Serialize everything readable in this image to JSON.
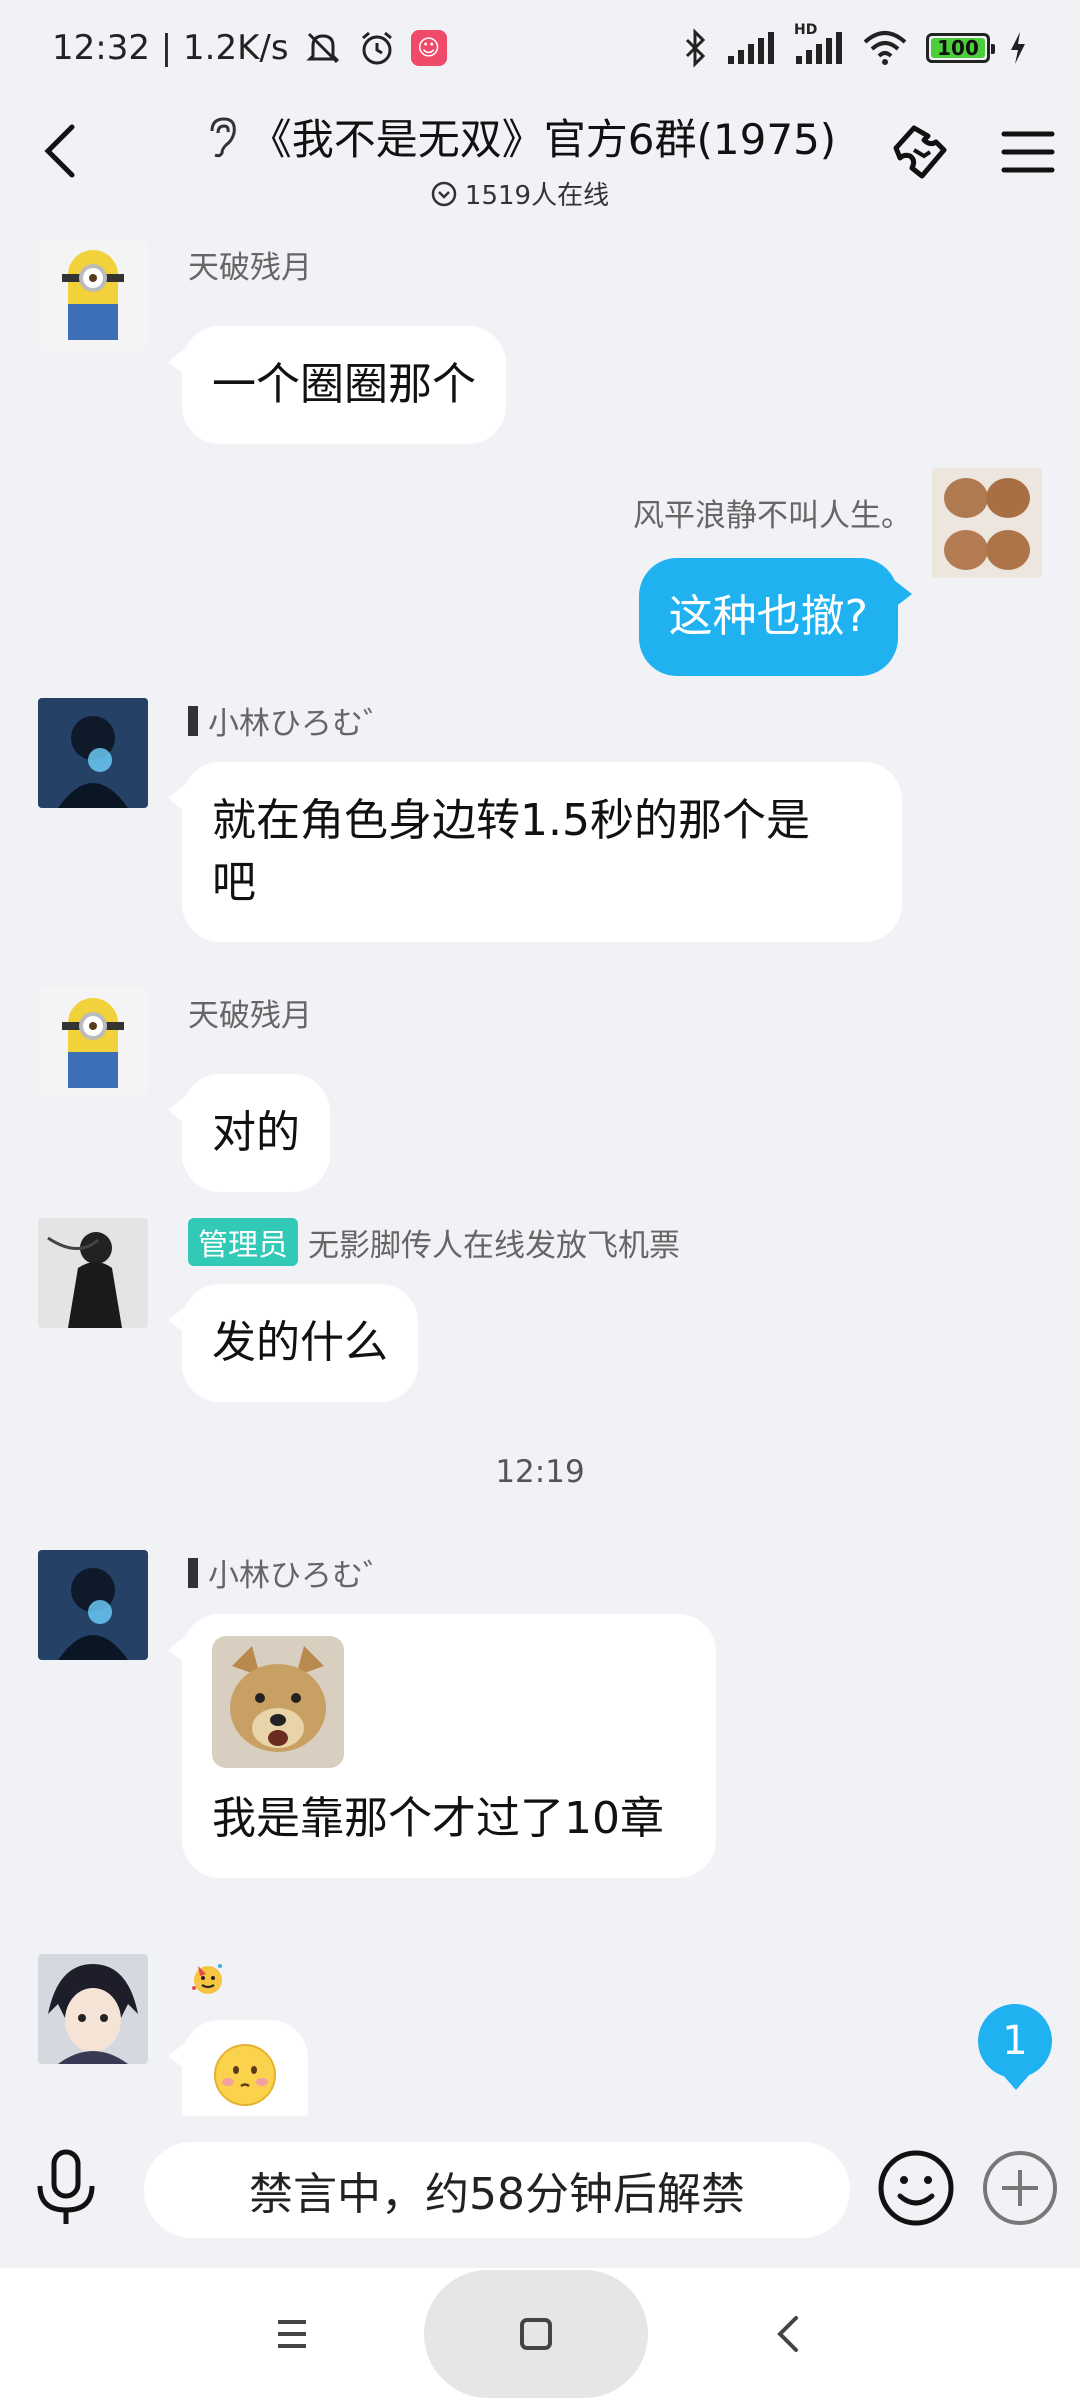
{
  "status_bar": {
    "time_speed": "12:32 | 1.2K/s",
    "battery": "100",
    "signal_hd": "HD"
  },
  "header": {
    "title": "《我不是无双》官方6群(1975)",
    "online": "1519人在线"
  },
  "messages": [
    {
      "sender": "天破残月",
      "text": "一个圈圈那个",
      "avatar": "minion-avatar"
    },
    {
      "sender": "风平浪静不叫人生。",
      "text": "这种也撤?",
      "avatar": "shoes-avatar",
      "mine": true
    },
    {
      "sender": "小林ひろむ゛",
      "text_line1": "就在角色身边转1.5秒的那个是",
      "text_line2": "吧",
      "avatar": "dark-avatar"
    },
    {
      "sender": "天破残月",
      "text": "对的",
      "avatar": "minion-avatar"
    },
    {
      "role": "管理员",
      "sender": "无影脚传人在线发放飞机票",
      "text": "发的什么",
      "avatar": "bw-avatar"
    },
    {
      "time": "12:19"
    },
    {
      "sender": "小林ひろむ゛",
      "text": "我是靠那个才过了10章",
      "avatar": "dark-avatar",
      "sticker": "dog-sticker"
    },
    {
      "sender_icon": "party-emoji",
      "avatar": "anime-avatar",
      "emoji": "blush-emoji"
    }
  ],
  "unread_count": "1",
  "input": {
    "muted_text": "禁言中，约58分钟后解禁"
  },
  "colors": {
    "accent": "#1fb1f0",
    "admin_tag": "#32c9b7",
    "background": "#f1f2f6"
  }
}
